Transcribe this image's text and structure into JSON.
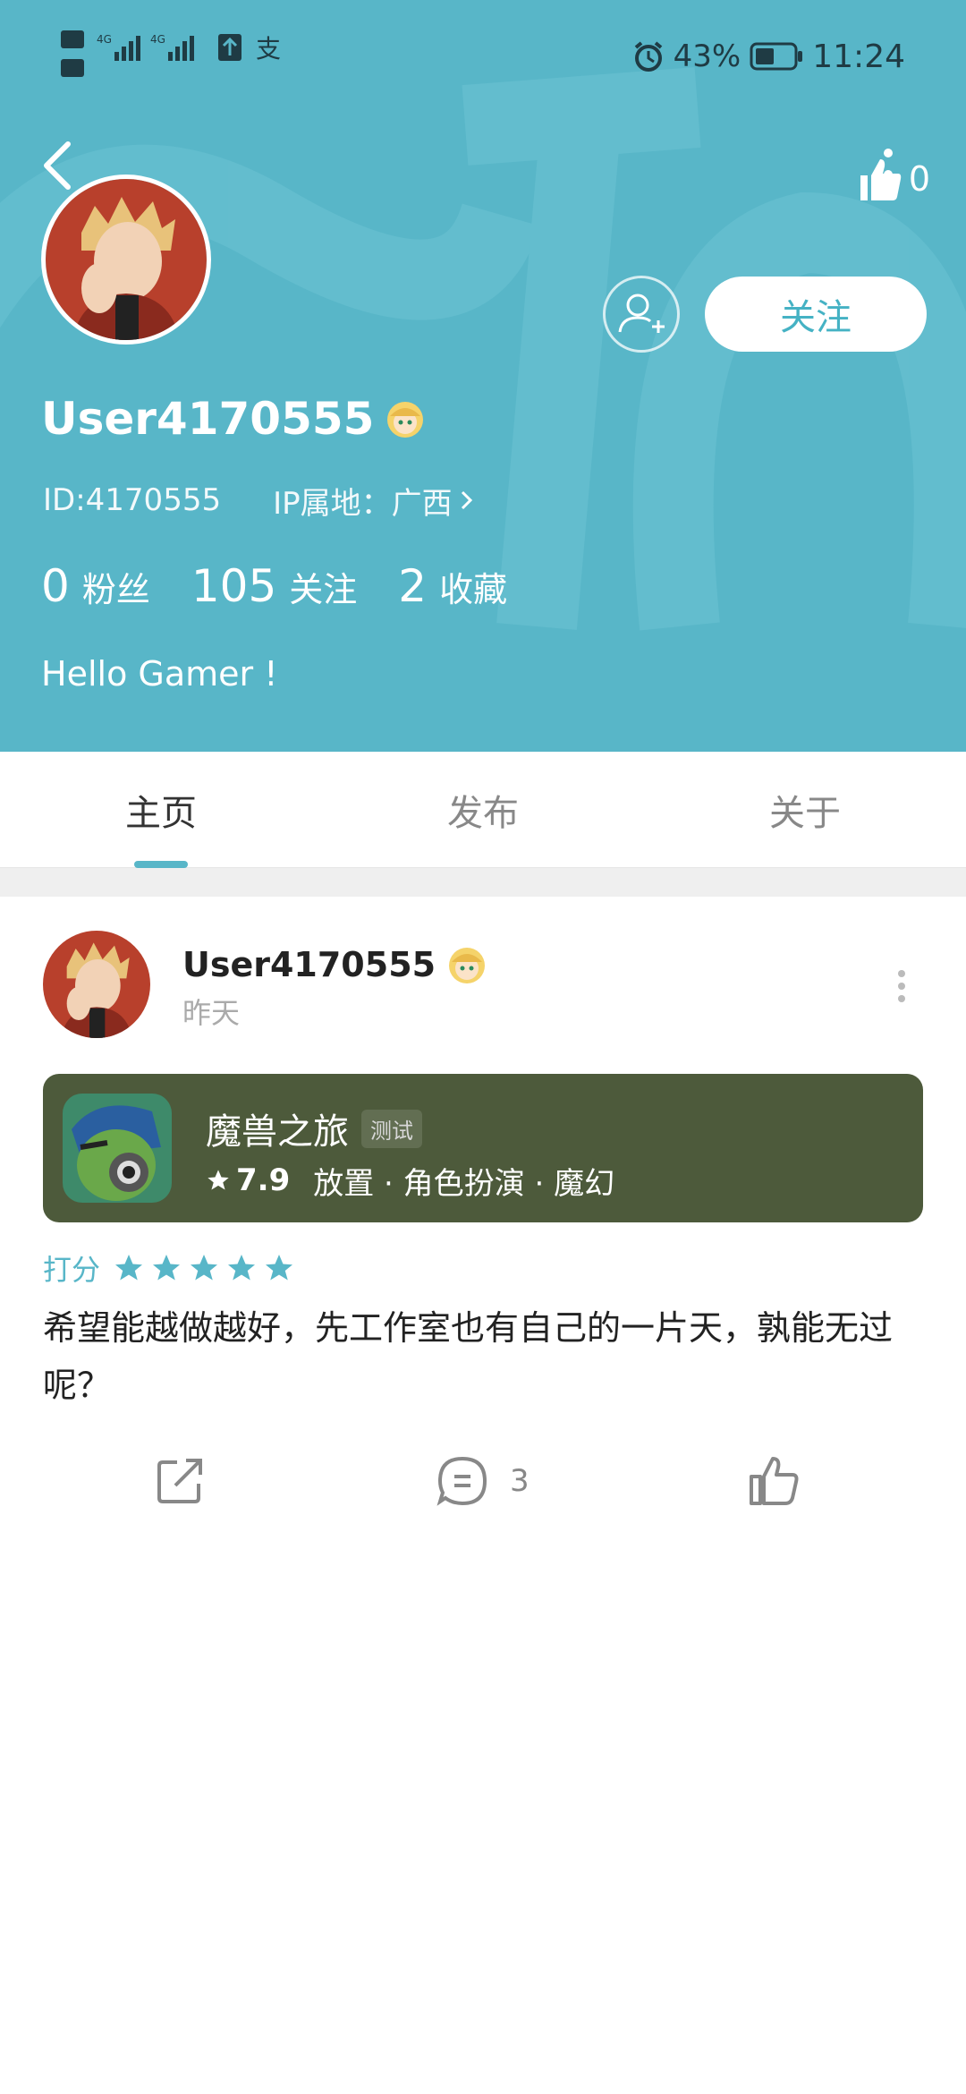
{
  "colors": {
    "header_bg": "#58b6c8",
    "accent": "#58b6c8",
    "game_card_bg": "#4d5a3b"
  },
  "status_bar": {
    "left_icons": [
      "hd1-icon",
      "hd2-icon",
      "signal-4g-icon",
      "signal-4g-icon",
      "upload-icon",
      "alipay-icon"
    ],
    "battery_percent": "43%",
    "time": "11:24"
  },
  "profile": {
    "like_count": "0",
    "follow_label": "关注",
    "username": "User4170555",
    "id_text": "ID:4170555",
    "ip_text": "IP属地：广西",
    "stats": [
      {
        "num": "0",
        "label": "粉丝"
      },
      {
        "num": "105",
        "label": "关注"
      },
      {
        "num": "2",
        "label": "收藏"
      }
    ],
    "bio": "Hello Gamer !"
  },
  "tabs": [
    {
      "label": "主页",
      "active": true
    },
    {
      "label": "发布",
      "active": false
    },
    {
      "label": "关于",
      "active": false
    }
  ],
  "post": {
    "username": "User4170555",
    "time": "昨天",
    "game": {
      "name": "魔兽之旅",
      "tag": "测试",
      "rating": "7.9",
      "genres": "放置 · 角色扮演 · 魔幻"
    },
    "rate_label": "打分",
    "stars": 5,
    "text": "希望能越做越好，先工作室也有自己的一片天，孰能无过呢？",
    "comment_count": "3"
  }
}
